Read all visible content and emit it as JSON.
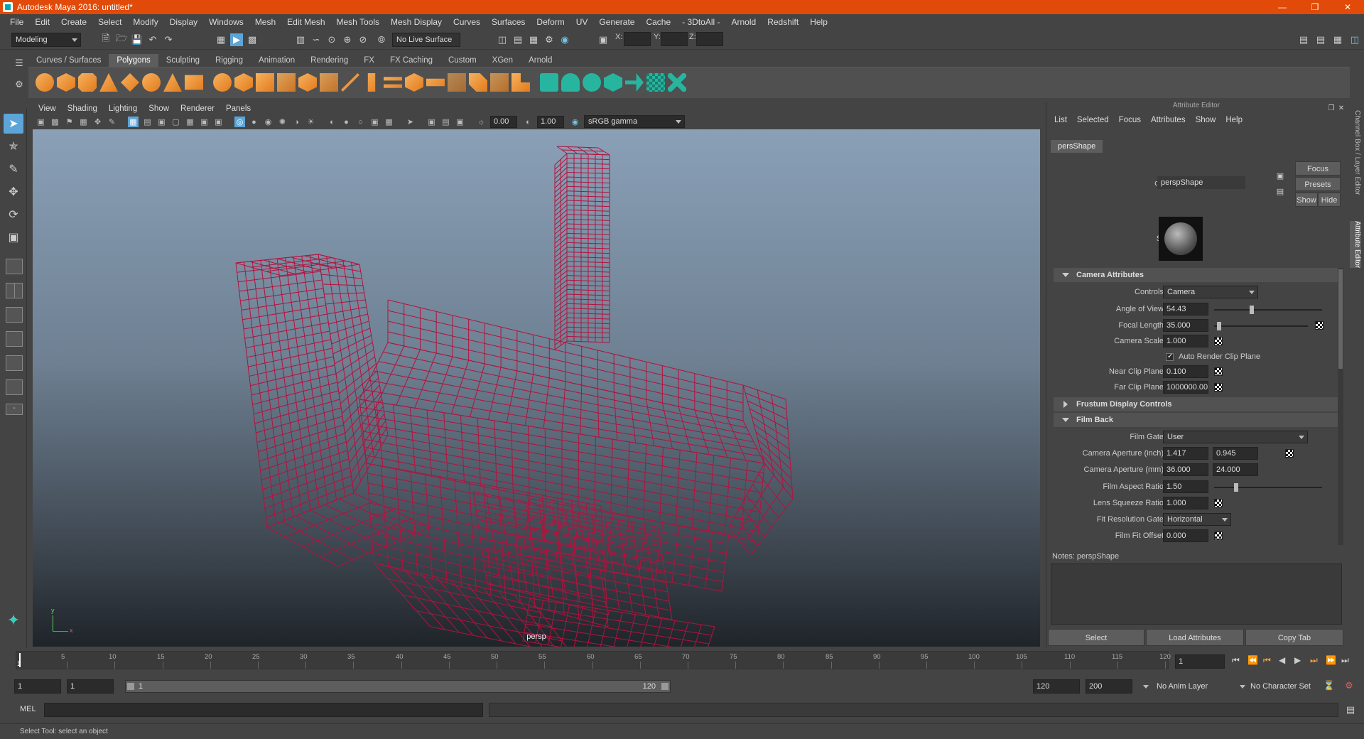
{
  "window": {
    "title": "Autodesk Maya 2016: untitled*"
  },
  "menus": [
    "File",
    "Edit",
    "Create",
    "Select",
    "Modify",
    "Display",
    "Windows",
    "Mesh",
    "Edit Mesh",
    "Mesh Tools",
    "Mesh Display",
    "Curves",
    "Surfaces",
    "Deform",
    "UV",
    "Generate",
    "Cache",
    "- 3DtoAll -",
    "Arnold",
    "Redshift",
    "Help"
  ],
  "statusline": {
    "mode": "Modeling",
    "live_surface": "No Live Surface",
    "x_label": "X:",
    "y_label": "Y:",
    "z_label": "Z:"
  },
  "shelf_tabs": [
    "Curves / Surfaces",
    "Polygons",
    "Sculpting",
    "Rigging",
    "Animation",
    "Rendering",
    "FX",
    "FX Caching",
    "Custom",
    "XGen",
    "Arnold"
  ],
  "shelf_active": "Polygons",
  "viewport": {
    "menus": [
      "View",
      "Shading",
      "Lighting",
      "Show",
      "Renderer",
      "Panels"
    ],
    "exposure": "0.00",
    "gamma": "1.00",
    "color_space": "sRGB gamma",
    "camera_label": "persp",
    "axis_x": "x",
    "axis_y": "y",
    "wire_color": "#b3123d"
  },
  "attr_editor": {
    "title": "Attribute Editor",
    "menus": [
      "List",
      "Selected",
      "Focus",
      "Attributes",
      "Show",
      "Help"
    ],
    "node_tab": "persShape",
    "camera_label": "camera:",
    "camera_value": "perspShape",
    "buttons": {
      "focus": "Focus",
      "presets": "Presets",
      "show": "Show",
      "hide": "Hide"
    },
    "sample_label": "Sample",
    "sections": {
      "camera_attributes": "Camera Attributes",
      "frustum": "Frustum Display Controls",
      "film_back": "Film Back"
    },
    "fields": {
      "controls_label": "Controls",
      "controls_value": "Camera",
      "aov_label": "Angle of View",
      "aov_value": "54.43",
      "focal_label": "Focal Length",
      "focal_value": "35.000",
      "scale_label": "Camera Scale",
      "scale_value": "1.000",
      "auto_clip_label": "Auto Render Clip Plane",
      "near_label": "Near Clip Plane",
      "near_value": "0.100",
      "far_label": "Far Clip Plane",
      "far_value": "1000000.000",
      "film_gate_label": "Film Gate",
      "film_gate_value": "User",
      "aperture_inch_label": "Camera Aperture (inch)",
      "aperture_inch_1": "1.417",
      "aperture_inch_2": "0.945",
      "aperture_mm_label": "Camera Aperture (mm)",
      "aperture_mm_1": "36.000",
      "aperture_mm_2": "24.000",
      "aspect_label": "Film Aspect Ratio",
      "aspect_value": "1.50",
      "squeeze_label": "Lens Squeeze Ratio",
      "squeeze_value": "1.000",
      "fit_gate_label": "Fit Resolution Gate",
      "fit_gate_value": "Horizontal",
      "fit_offset_label": "Film Fit Offset",
      "fit_offset_value": "0.000"
    },
    "notes_label": "Notes:  perspShape",
    "bottom_buttons": {
      "select": "Select",
      "load": "Load Attributes",
      "copy": "Copy Tab"
    }
  },
  "sidetabs": {
    "channel_box": "Channel Box / Layer Editor",
    "attribute_editor": "Attribute Editor"
  },
  "timeline": {
    "ticks": [
      "5",
      "10",
      "15",
      "20",
      "25",
      "30",
      "35",
      "40",
      "45",
      "50",
      "55",
      "60",
      "65",
      "70",
      "75",
      "80",
      "85",
      "90",
      "95",
      "100",
      "105",
      "110",
      "115",
      "120"
    ],
    "current_frame": "1"
  },
  "range": {
    "start": "1",
    "playback_start": "1",
    "slider_start": "1",
    "slider_end": "120",
    "playback_end": "120",
    "end": "200",
    "anim_layer": "No Anim Layer",
    "character_set": "No Character Set"
  },
  "mel": {
    "label": "MEL"
  },
  "help_line": "Select Tool: select an object"
}
